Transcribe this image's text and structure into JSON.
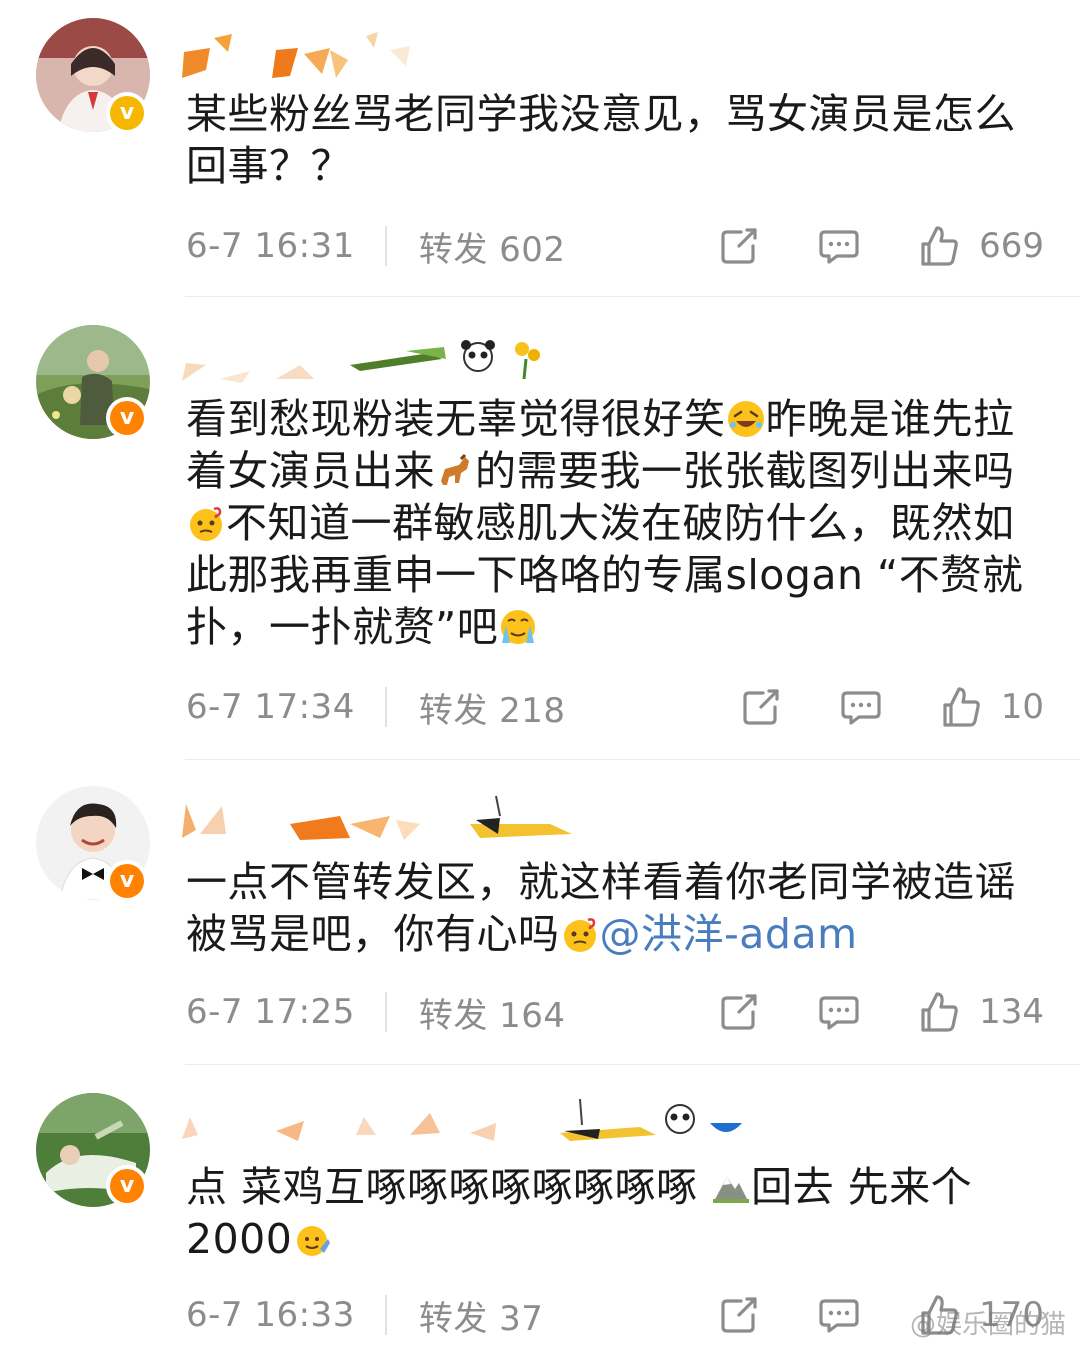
{
  "posts": [
    {
      "text_parts": [
        {
          "kind": "text",
          "value": "某些粉丝骂老同学我没意见，骂女演员是怎么回事？？"
        }
      ],
      "time": "6-7 16:31",
      "repost_label": "转发",
      "repost_count": "602",
      "like_count": "669",
      "badge_color": "#f5b700",
      "badge_icon": "v-icon"
    },
    {
      "text_parts": [
        {
          "kind": "text",
          "value": "看到愁现粉装无辜觉得很好笑"
        },
        {
          "kind": "emoji",
          "name": "rofl-emoji"
        },
        {
          "kind": "text",
          "value": "昨晚是谁先拉着女演员出来"
        },
        {
          "kind": "emoji",
          "name": "horse-emoji"
        },
        {
          "kind": "text",
          "value": "的需要我一张张截图列出来吗"
        },
        {
          "kind": "emoji",
          "name": "question-face-emoji"
        },
        {
          "kind": "text",
          "value": "不知道一群敏感肌大泼在破防什么，既然如此那我再重申一下咯咯的专属slogan “不赘就扑，一扑就赘”吧"
        },
        {
          "kind": "emoji",
          "name": "crying-emoji"
        }
      ],
      "time": "6-7 17:34",
      "repost_label": "转发",
      "repost_count": "218",
      "like_count": "10",
      "badge_color": "#ff8200",
      "badge_icon": "v-icon"
    },
    {
      "text_parts": [
        {
          "kind": "text",
          "value": "一点不管转发区，就这样看着你老同学被造谣被骂是吧，你有心吗"
        },
        {
          "kind": "emoji",
          "name": "question-face-emoji"
        },
        {
          "kind": "mention",
          "value": "@洪洋-adam"
        }
      ],
      "time": "6-7 17:25",
      "repost_label": "转发",
      "repost_count": "164",
      "like_count": "134",
      "badge_color": "#ff8200",
      "badge_icon": "v-icon"
    },
    {
      "text_parts": [
        {
          "kind": "text",
          "value": "点 菜鸡互啄啄啄啄啄啄啄啄 "
        },
        {
          "kind": "emoji",
          "name": "mountain-emoji"
        },
        {
          "kind": "text",
          "value": "回去 先来个2000"
        },
        {
          "kind": "emoji",
          "name": "waving-emoji"
        }
      ],
      "time": "6-7 16:33",
      "repost_label": "转发",
      "repost_count": "37",
      "like_count": "170",
      "badge_color": "#ff8200",
      "badge_icon": "v-icon"
    }
  ],
  "watermark": "@娱乐圈的猫"
}
